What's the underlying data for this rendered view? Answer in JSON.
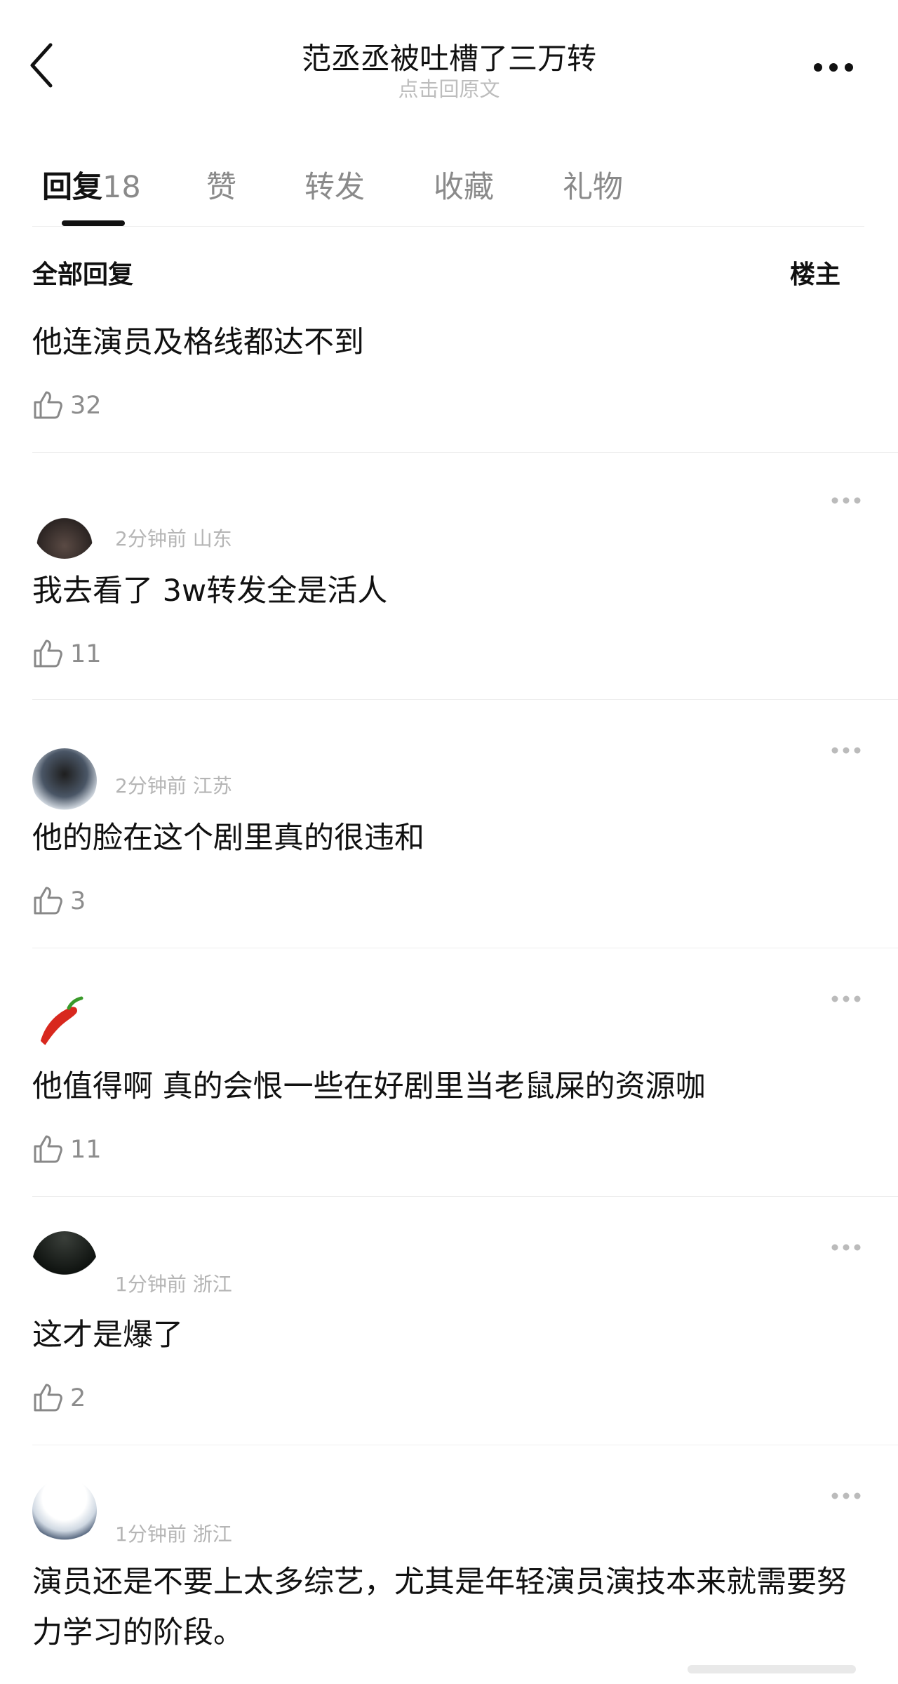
{
  "header": {
    "title": "范丞丞被吐槽了三万转",
    "subtitle": "点击回原文"
  },
  "tabs": [
    {
      "label": "回复",
      "count": "18"
    },
    {
      "label": "赞"
    },
    {
      "label": "转发"
    },
    {
      "label": "收藏"
    },
    {
      "label": "礼物"
    }
  ],
  "section": {
    "title": "全部回复",
    "right_label": "楼主"
  },
  "comments": [
    {
      "text": "他连演员及格线都达不到",
      "likes": "32"
    },
    {
      "meta": "2分钟前 山东",
      "text": "我去看了 3w转发全是活人",
      "likes": "11"
    },
    {
      "meta": "2分钟前 江苏",
      "text": "他的脸在这个剧里真的很违和",
      "likes": "3"
    },
    {
      "text": "他值得啊 真的会恨一些在好剧里当老鼠屎的资源咖",
      "likes": "11"
    },
    {
      "meta": "1分钟前 浙江",
      "text": "这才是爆了",
      "likes": "2"
    },
    {
      "meta": "1分钟前 浙江",
      "text": "演员还是不要上太多综艺，尤其是年轻演员演技本来就需要努力学习的阶段。"
    }
  ],
  "icons": {
    "back": "chevron-left-icon",
    "more": "more-dots-icon",
    "like": "thumbs-up-icon"
  },
  "colors": {
    "text": "#111111",
    "muted": "#8c8c8c",
    "meta": "#b5b5b5",
    "divider": "#eeeeee"
  }
}
